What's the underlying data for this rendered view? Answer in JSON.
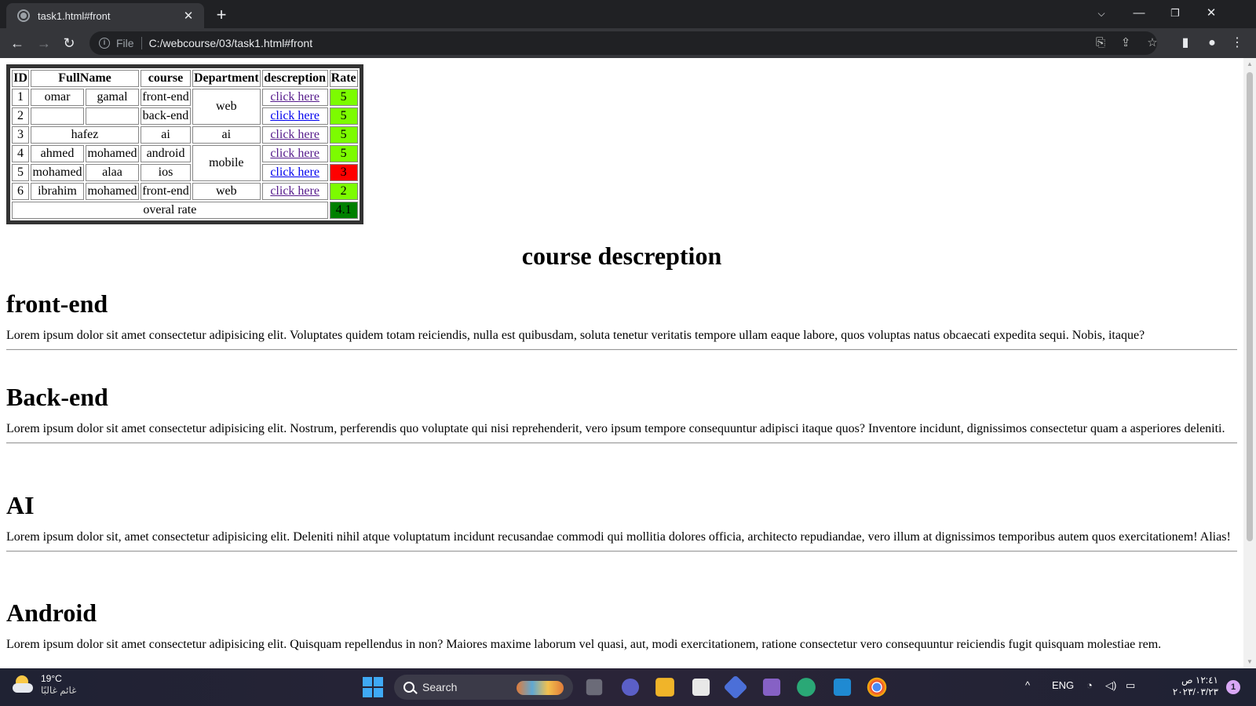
{
  "browser": {
    "tab_title": "task1.html#front",
    "tab_close": "✕",
    "new_tab": "+",
    "url_scheme": "File",
    "url": "C:/webcourse/03/task1.html#front"
  },
  "table": {
    "headers": [
      "ID",
      "FullName",
      "course",
      "Department",
      "descreption",
      "Rate"
    ],
    "rows": [
      {
        "id": "1",
        "first": "omar",
        "last": "gamal",
        "course": "front-end",
        "department": "web",
        "link": "click here",
        "rate": "5"
      },
      {
        "id": "2",
        "first": "",
        "last": "",
        "course": "back-end",
        "link": "click here",
        "rate": "5"
      },
      {
        "id": "3",
        "full": "hafez",
        "course": "ai",
        "department": "ai",
        "link": "click here",
        "rate": "5"
      },
      {
        "id": "4",
        "first": "ahmed",
        "last": "mohamed",
        "course": "android",
        "department": "mobile",
        "link": "click here",
        "rate": "5"
      },
      {
        "id": "5",
        "first": "mohamed",
        "last": "alaa",
        "course": "ios",
        "link": "click here",
        "rate": "3"
      },
      {
        "id": "6",
        "first": "ibrahim",
        "last": "mohamed",
        "course": "front-end",
        "department": "web",
        "link": "click here",
        "rate": "2"
      }
    ],
    "footer_label": "overal rate",
    "footer_value": "4.1",
    "colors": {
      "good": "#7cfc00",
      "bad": "#ff0000",
      "overall": "#008000"
    }
  },
  "page": {
    "section_heading": "course descreption",
    "sections": [
      {
        "title": "front-end",
        "text": "Lorem ipsum dolor sit amet consectetur adipisicing elit. Voluptates quidem totam reiciendis, nulla est quibusdam, soluta tenetur veritatis tempore ullam eaque labore, quos voluptas natus obcaecati expedita sequi. Nobis, itaque?"
      },
      {
        "title": "Back-end",
        "text": "Lorem ipsum dolor sit amet consectetur adipisicing elit. Nostrum, perferendis quo voluptate qui nisi reprehenderit, vero ipsum tempore consequuntur adipisci itaque quos? Inventore incidunt, dignissimos consectetur quam a asperiores deleniti."
      },
      {
        "title": "AI",
        "text": "Lorem ipsum dolor sit, amet consectetur adipisicing elit. Deleniti nihil atque voluptatum incidunt recusandae commodi qui mollitia dolores officia, architecto repudiandae, vero illum at dignissimos temporibus autem quos exercitationem! Alias!"
      },
      {
        "title": "Android",
        "text": "Lorem ipsum dolor sit amet consectetur adipisicing elit. Quisquam repellendus in non? Maiores maxime laborum vel quasi, aut, modi exercitationem, ratione consectetur vero consequuntur reiciendis fugit quisquam molestiae rem."
      }
    ]
  },
  "taskbar": {
    "weather_temp": "19°C",
    "weather_cond": "غائم غالبًا",
    "search_label": "Search",
    "language": "ENG",
    "clock_time": "١٢:٤١ ص",
    "clock_date": "٢٠٢٣/٠٣/٢٣",
    "notification_count": "1"
  }
}
